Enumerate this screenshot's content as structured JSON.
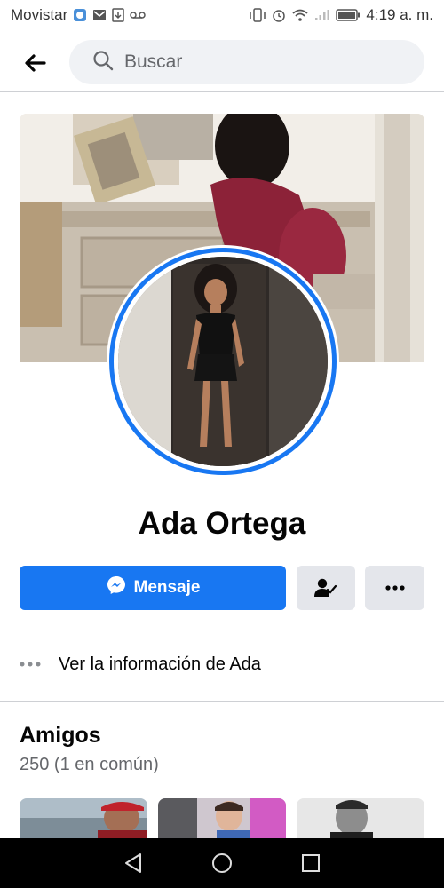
{
  "status_bar": {
    "carrier": "Movistar",
    "time": "4:19 a. m."
  },
  "search": {
    "placeholder": "Buscar"
  },
  "profile": {
    "name": "Ada Ortega"
  },
  "actions": {
    "message_label": "Mensaje"
  },
  "info": {
    "label": "Ver la información de Ada"
  },
  "friends": {
    "title": "Amigos",
    "count_text": "250 (1 en común)"
  },
  "colors": {
    "accent": "#1877f2",
    "button_gray": "#e4e6eb",
    "search_bg": "#f0f2f5",
    "secondary_text": "#65676b"
  },
  "icons": {
    "back": "arrow-left-icon",
    "search": "search-icon",
    "messenger": "messenger-icon",
    "friend_status": "friend-check-icon",
    "more": "more-horizontal-icon",
    "info_more": "ellipsis-icon"
  }
}
